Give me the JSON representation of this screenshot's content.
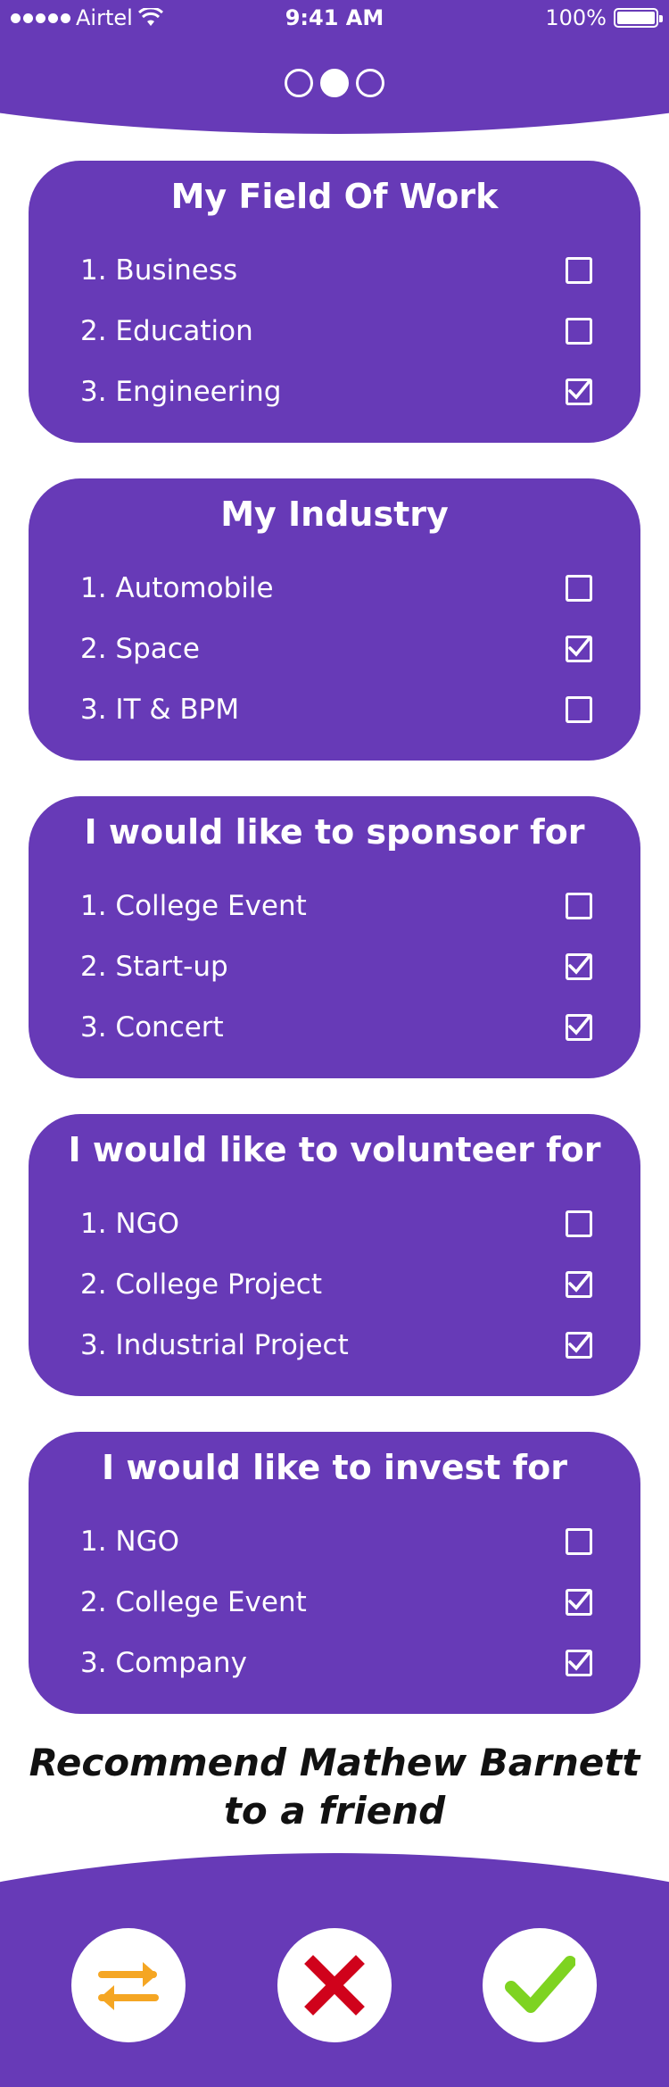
{
  "status_bar": {
    "carrier": "Airtel",
    "time": "9:41 AM",
    "battery": "100%",
    "icons": [
      "signal-dots-icon",
      "wifi-icon",
      "battery-icon"
    ]
  },
  "pager": {
    "total_pages": 3,
    "active_page": 2
  },
  "sections": [
    {
      "title": "My Field Of Work",
      "options": [
        {
          "label": "1. Business",
          "checked": false
        },
        {
          "label": "2. Education",
          "checked": false
        },
        {
          "label": "3. Engineering",
          "checked": true
        }
      ]
    },
    {
      "title": "My Industry",
      "options": [
        {
          "label": "1. Automobile",
          "checked": false
        },
        {
          "label": "2. Space",
          "checked": true
        },
        {
          "label": "3. IT & BPM",
          "checked": false
        }
      ]
    },
    {
      "title": "I would like to sponsor for",
      "options": [
        {
          "label": "1. College Event",
          "checked": false
        },
        {
          "label": "2. Start-up",
          "checked": true
        },
        {
          "label": "3. Concert",
          "checked": true
        }
      ]
    },
    {
      "title": "I would like to volunteer for",
      "options": [
        {
          "label": "1. NGO",
          "checked": false
        },
        {
          "label": "2. College Project",
          "checked": true
        },
        {
          "label": "3. Industrial Project",
          "checked": true
        }
      ]
    },
    {
      "title": "I would like to invest for",
      "options": [
        {
          "label": "1. NGO",
          "checked": false
        },
        {
          "label": "2. College Event",
          "checked": true
        },
        {
          "label": "3. Company",
          "checked": true
        }
      ]
    }
  ],
  "recommend": {
    "line1": "Recommend Mathew Barnett",
    "line2": "to a friend"
  },
  "actions": [
    {
      "icon": "swap-arrows-icon",
      "color": "#f5a623"
    },
    {
      "icon": "close-icon",
      "color": "#d0021b"
    },
    {
      "icon": "checkmark-icon",
      "color": "#7ed321"
    }
  ],
  "colors": {
    "primary": "#673ab7",
    "on_primary": "#ffffff",
    "text_dark": "#111111"
  }
}
